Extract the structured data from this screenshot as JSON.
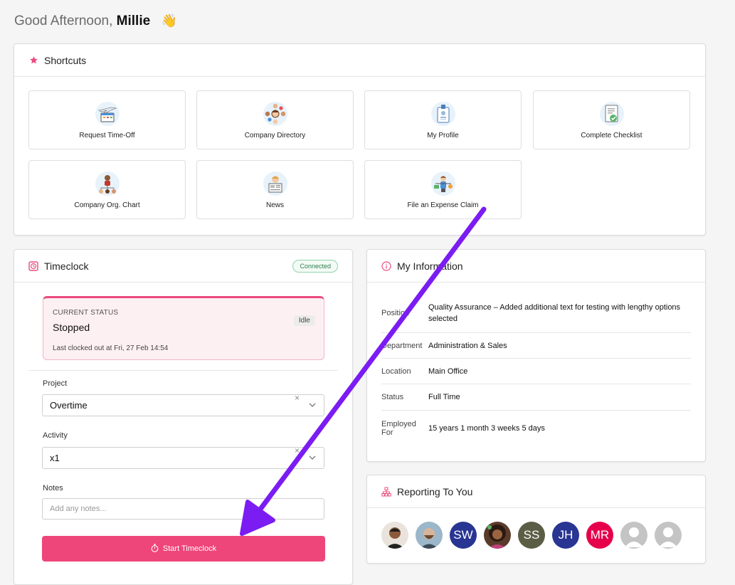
{
  "greeting": {
    "prefix": "Good Afternoon,",
    "name": "Millie",
    "emoji": "👋"
  },
  "shortcuts": {
    "title": "Shortcuts",
    "items": [
      {
        "label": "Request Time-Off",
        "icon": "airplane-calendar-illustration"
      },
      {
        "label": "Company Directory",
        "icon": "people-network-illustration"
      },
      {
        "label": "My Profile",
        "icon": "id-badge-illustration"
      },
      {
        "label": "Complete Checklist",
        "icon": "checklist-illustration"
      },
      {
        "label": "Company Org. Chart",
        "icon": "org-chart-illustration"
      },
      {
        "label": "News",
        "icon": "newspaper-reader-illustration"
      },
      {
        "label": "File an Expense Claim",
        "icon": "expense-scale-illustration"
      }
    ]
  },
  "timeclock": {
    "title": "Timeclock",
    "connection": "Connected",
    "status": {
      "caption": "CURRENT STATUS",
      "value": "Stopped",
      "badge": "Idle",
      "last_clocked": "Last clocked out at Fri, 27 Feb 14:54"
    },
    "project": {
      "label": "Project",
      "value": "Overtime"
    },
    "activity": {
      "label": "Activity",
      "value": "x1"
    },
    "notes": {
      "label": "Notes",
      "placeholder": "Add any notes..."
    },
    "start_button": "Start Timeclock",
    "clear_glyph": "×"
  },
  "my_information": {
    "title": "My Information",
    "rows": [
      {
        "key": "Position",
        "value": "Quality Assurance – Added additional text for testing with lengthy options selected"
      },
      {
        "key": "Department",
        "value": "Administration & Sales"
      },
      {
        "key": "Location",
        "value": "Main Office"
      },
      {
        "key": "Status",
        "value": "Full Time"
      },
      {
        "key": "Employed For",
        "value": "15 years 1 month 3 weeks 5 days"
      }
    ]
  },
  "reporting": {
    "title": "Reporting To You",
    "avatars": [
      {
        "kind": "photo",
        "initials": "",
        "color": "#e9e3dc"
      },
      {
        "kind": "photo",
        "initials": "",
        "color": "#9bb7c9"
      },
      {
        "kind": "initials",
        "initials": "SW",
        "color": "#283593"
      },
      {
        "kind": "photo",
        "initials": "",
        "color": "#5a3b2a"
      },
      {
        "kind": "initials",
        "initials": "SS",
        "color": "#5b5e44"
      },
      {
        "kind": "initials",
        "initials": "JH",
        "color": "#283593"
      },
      {
        "kind": "initials",
        "initials": "MR",
        "color": "#e6004c"
      },
      {
        "kind": "placeholder",
        "initials": "",
        "color": "#bdbdbd"
      },
      {
        "kind": "placeholder",
        "initials": "",
        "color": "#bdbdbd"
      }
    ]
  },
  "colors": {
    "accent": "#ee467a",
    "annotation_arrow": "#7b1cf2",
    "connected": "#2e7d4f"
  }
}
